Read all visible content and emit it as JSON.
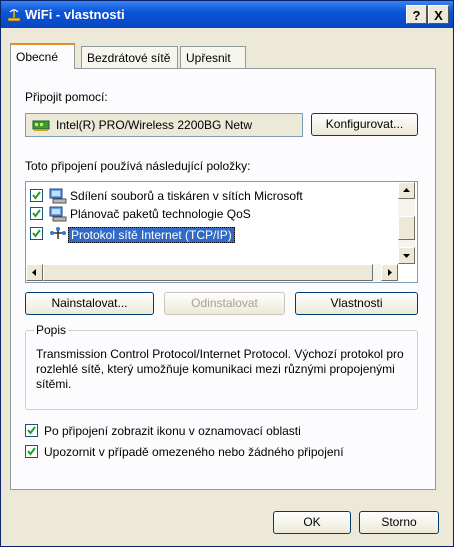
{
  "window": {
    "title": "WiFi - vlastnosti",
    "help_label": "?",
    "close_label": "X"
  },
  "tabs": [
    {
      "label": "Obecné"
    },
    {
      "label": "Bezdrátové sítě"
    },
    {
      "label": "Upřesnit"
    }
  ],
  "connect_using": {
    "label": "Připojit pomocí:",
    "adapter": "Intel(R) PRO/Wireless 2200BG Netw",
    "configure_button": "Konfigurovat..."
  },
  "components": {
    "label": "Toto připojení používá následující položky:",
    "items": [
      {
        "label": "Sdílení souborů a tiskáren v sítích Microsoft",
        "checked": true,
        "icon": "network-service-icon"
      },
      {
        "label": "Plánovač paketů technologie QoS",
        "checked": true,
        "icon": "network-service-icon"
      },
      {
        "label": "Protokol sítě Internet (TCP/IP)",
        "checked": true,
        "icon": "protocol-icon",
        "selected": true
      }
    ]
  },
  "buttons": {
    "install": "Nainstalovat...",
    "uninstall": "Odinstalovat",
    "properties": "Vlastnosti",
    "ok": "OK",
    "cancel": "Storno"
  },
  "description": {
    "title": "Popis",
    "text": "Transmission Control Protocol/Internet Protocol. Výchozí protokol pro rozlehlé sítě, který umožňuje komunikaci mezi různými propojenými sítěmi."
  },
  "options": [
    {
      "label": "Po připojení zobrazit ikonu v oznamovací oblasti",
      "checked": true
    },
    {
      "label": "Upozornit v případě omezeného nebo žádného připojení",
      "checked": true
    }
  ],
  "colors": {
    "titlebar": "#0b55d8",
    "selection": "#316ac5",
    "tab_highlight": "#e68b2c"
  }
}
